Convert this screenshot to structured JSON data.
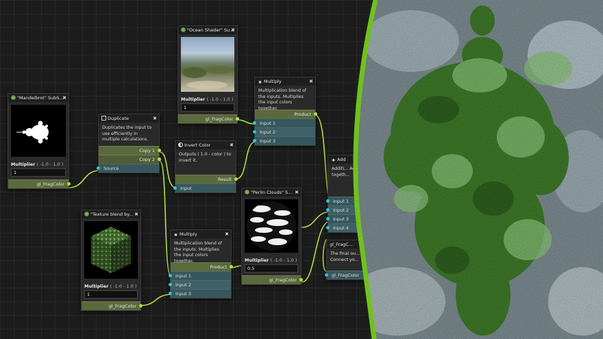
{
  "nodes": {
    "mandelbrot": {
      "title": "\"Mandelbrot\" SubS...",
      "param_label": "Multiplier",
      "param_range": "( -1.0 - 1.0 )",
      "param_value": "1",
      "output": "gl_FragColor"
    },
    "duplicate": {
      "title": "Duplicate",
      "description": "Duplicates the input to use efficiently in multiple calculations.",
      "out1": "Copy 1",
      "out2": "Copy 2",
      "input": "Source"
    },
    "ocean": {
      "title": "\"Ocean Shader\" Su...",
      "param_label": "Multiplier",
      "param_range": "( -1.0 - 1.0 )",
      "param_value": "1",
      "output": "gl_FragColor"
    },
    "invert": {
      "title": "Invert Color",
      "description": "Outputs ( 1.0 - color ) to invert it.",
      "output": "Result",
      "input": "Input"
    },
    "multiply_top": {
      "title": "Multiply",
      "description": "Multiplication blend of the inputs. Multiplies the input colors together.",
      "output": "Product",
      "in1": "Input 1",
      "in2": "Input 2",
      "in3": "Input 3"
    },
    "texture": {
      "title": "\"Texture blend by...",
      "param_label": "Multiplier",
      "param_range": "( -1.0 - 1.0 )",
      "param_value": "1",
      "output": "gl_FragColor"
    },
    "multiply_bottom": {
      "title": "Multiply",
      "description": "Multiplication blend of the inputs. Multiplies the input colors together.",
      "output": "Product",
      "in1": "Input 1",
      "in2": "Input 2",
      "in3": "Input 3"
    },
    "perlin": {
      "title": "\"Perlin Clouds\" S...",
      "param_label": "Multiplier",
      "param_range": "( -1.0 - 1.0 )",
      "param_value": "0.5",
      "output": "gl_FragColor"
    },
    "add": {
      "title": "Add",
      "description": "Additi... Adds t... togeth...",
      "in1": "Input 1",
      "in2": "Input 2",
      "in3": "Input 3",
      "in4": "Input 4"
    },
    "frag": {
      "title": "gl_FragC...",
      "description": "The final ou... Connect yo...",
      "input": "gl_FragColor"
    }
  },
  "colors": {
    "accent_green": "#7ac41c",
    "output_port": "#5a6a3c",
    "input_port": "#38575c",
    "wire": "#b4e040"
  }
}
